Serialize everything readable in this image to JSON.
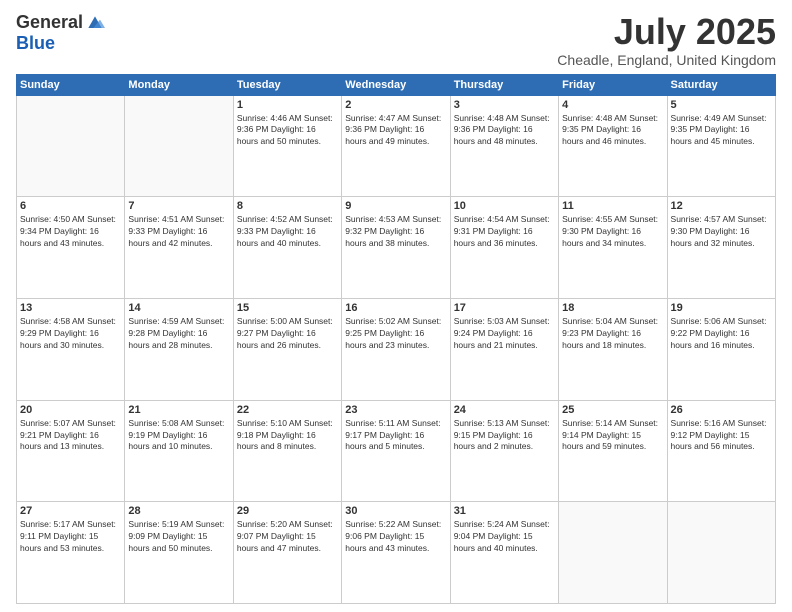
{
  "header": {
    "logo_general": "General",
    "logo_blue": "Blue",
    "month_title": "July 2025",
    "location": "Cheadle, England, United Kingdom"
  },
  "days_of_week": [
    "Sunday",
    "Monday",
    "Tuesday",
    "Wednesday",
    "Thursday",
    "Friday",
    "Saturday"
  ],
  "weeks": [
    [
      {
        "day": "",
        "info": ""
      },
      {
        "day": "",
        "info": ""
      },
      {
        "day": "1",
        "info": "Sunrise: 4:46 AM\nSunset: 9:36 PM\nDaylight: 16 hours\nand 50 minutes."
      },
      {
        "day": "2",
        "info": "Sunrise: 4:47 AM\nSunset: 9:36 PM\nDaylight: 16 hours\nand 49 minutes."
      },
      {
        "day": "3",
        "info": "Sunrise: 4:48 AM\nSunset: 9:36 PM\nDaylight: 16 hours\nand 48 minutes."
      },
      {
        "day": "4",
        "info": "Sunrise: 4:48 AM\nSunset: 9:35 PM\nDaylight: 16 hours\nand 46 minutes."
      },
      {
        "day": "5",
        "info": "Sunrise: 4:49 AM\nSunset: 9:35 PM\nDaylight: 16 hours\nand 45 minutes."
      }
    ],
    [
      {
        "day": "6",
        "info": "Sunrise: 4:50 AM\nSunset: 9:34 PM\nDaylight: 16 hours\nand 43 minutes."
      },
      {
        "day": "7",
        "info": "Sunrise: 4:51 AM\nSunset: 9:33 PM\nDaylight: 16 hours\nand 42 minutes."
      },
      {
        "day": "8",
        "info": "Sunrise: 4:52 AM\nSunset: 9:33 PM\nDaylight: 16 hours\nand 40 minutes."
      },
      {
        "day": "9",
        "info": "Sunrise: 4:53 AM\nSunset: 9:32 PM\nDaylight: 16 hours\nand 38 minutes."
      },
      {
        "day": "10",
        "info": "Sunrise: 4:54 AM\nSunset: 9:31 PM\nDaylight: 16 hours\nand 36 minutes."
      },
      {
        "day": "11",
        "info": "Sunrise: 4:55 AM\nSunset: 9:30 PM\nDaylight: 16 hours\nand 34 minutes."
      },
      {
        "day": "12",
        "info": "Sunrise: 4:57 AM\nSunset: 9:30 PM\nDaylight: 16 hours\nand 32 minutes."
      }
    ],
    [
      {
        "day": "13",
        "info": "Sunrise: 4:58 AM\nSunset: 9:29 PM\nDaylight: 16 hours\nand 30 minutes."
      },
      {
        "day": "14",
        "info": "Sunrise: 4:59 AM\nSunset: 9:28 PM\nDaylight: 16 hours\nand 28 minutes."
      },
      {
        "day": "15",
        "info": "Sunrise: 5:00 AM\nSunset: 9:27 PM\nDaylight: 16 hours\nand 26 minutes."
      },
      {
        "day": "16",
        "info": "Sunrise: 5:02 AM\nSunset: 9:25 PM\nDaylight: 16 hours\nand 23 minutes."
      },
      {
        "day": "17",
        "info": "Sunrise: 5:03 AM\nSunset: 9:24 PM\nDaylight: 16 hours\nand 21 minutes."
      },
      {
        "day": "18",
        "info": "Sunrise: 5:04 AM\nSunset: 9:23 PM\nDaylight: 16 hours\nand 18 minutes."
      },
      {
        "day": "19",
        "info": "Sunrise: 5:06 AM\nSunset: 9:22 PM\nDaylight: 16 hours\nand 16 minutes."
      }
    ],
    [
      {
        "day": "20",
        "info": "Sunrise: 5:07 AM\nSunset: 9:21 PM\nDaylight: 16 hours\nand 13 minutes."
      },
      {
        "day": "21",
        "info": "Sunrise: 5:08 AM\nSunset: 9:19 PM\nDaylight: 16 hours\nand 10 minutes."
      },
      {
        "day": "22",
        "info": "Sunrise: 5:10 AM\nSunset: 9:18 PM\nDaylight: 16 hours\nand 8 minutes."
      },
      {
        "day": "23",
        "info": "Sunrise: 5:11 AM\nSunset: 9:17 PM\nDaylight: 16 hours\nand 5 minutes."
      },
      {
        "day": "24",
        "info": "Sunrise: 5:13 AM\nSunset: 9:15 PM\nDaylight: 16 hours\nand 2 minutes."
      },
      {
        "day": "25",
        "info": "Sunrise: 5:14 AM\nSunset: 9:14 PM\nDaylight: 15 hours\nand 59 minutes."
      },
      {
        "day": "26",
        "info": "Sunrise: 5:16 AM\nSunset: 9:12 PM\nDaylight: 15 hours\nand 56 minutes."
      }
    ],
    [
      {
        "day": "27",
        "info": "Sunrise: 5:17 AM\nSunset: 9:11 PM\nDaylight: 15 hours\nand 53 minutes."
      },
      {
        "day": "28",
        "info": "Sunrise: 5:19 AM\nSunset: 9:09 PM\nDaylight: 15 hours\nand 50 minutes."
      },
      {
        "day": "29",
        "info": "Sunrise: 5:20 AM\nSunset: 9:07 PM\nDaylight: 15 hours\nand 47 minutes."
      },
      {
        "day": "30",
        "info": "Sunrise: 5:22 AM\nSunset: 9:06 PM\nDaylight: 15 hours\nand 43 minutes."
      },
      {
        "day": "31",
        "info": "Sunrise: 5:24 AM\nSunset: 9:04 PM\nDaylight: 15 hours\nand 40 minutes."
      },
      {
        "day": "",
        "info": ""
      },
      {
        "day": "",
        "info": ""
      }
    ]
  ]
}
